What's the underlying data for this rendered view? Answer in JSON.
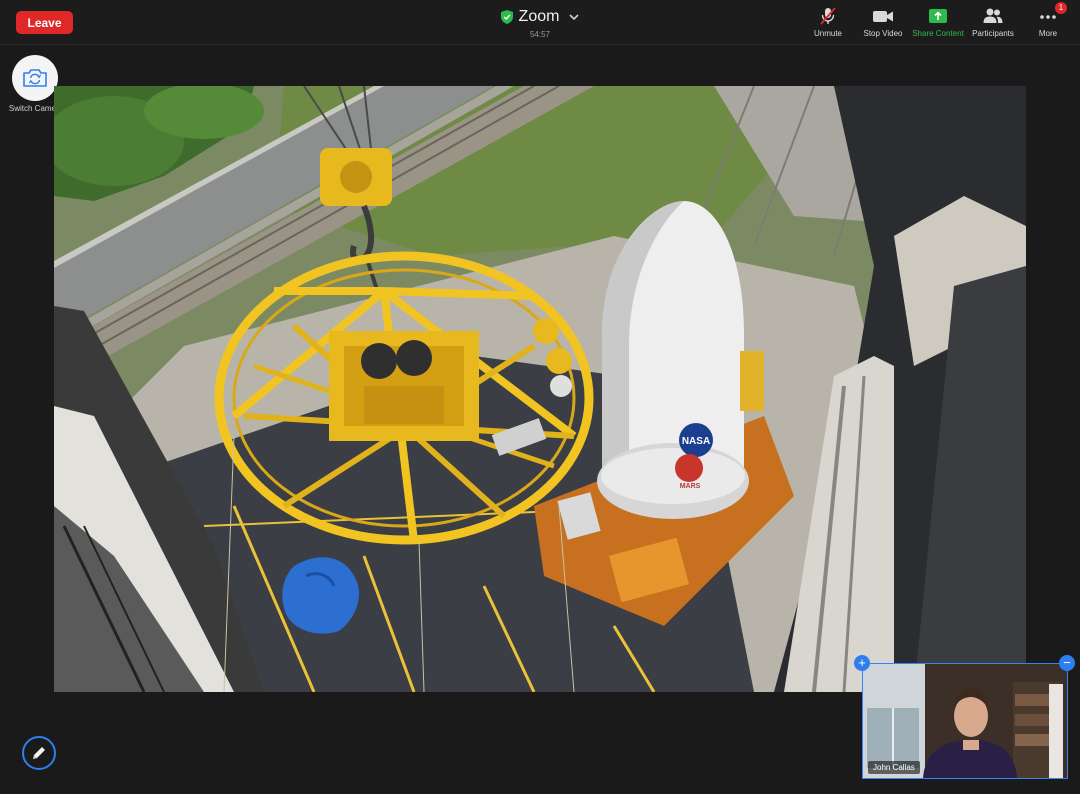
{
  "toolbar": {
    "leave_label": "Leave",
    "app_title": "Zoom",
    "timer": "54:57",
    "tools": [
      {
        "label": "Unmute",
        "icon": "mic-muted-icon"
      },
      {
        "label": "Stop Video",
        "icon": "video-camera-icon"
      },
      {
        "label": "Share Content",
        "icon": "share-screen-icon",
        "color": "#2dbb4e"
      },
      {
        "label": "Participants",
        "icon": "participants-icon"
      },
      {
        "label": "More",
        "icon": "more-dots-icon",
        "badge": "1"
      }
    ]
  },
  "camera": {
    "switch_label": "Switch Camera"
  },
  "shared_content": {
    "nasa_logo": "NASA",
    "mars_logo": "MARS"
  },
  "thumbnail": {
    "participant_name": "John Callas",
    "expand_symbol": "+",
    "collapse_symbol": "−"
  },
  "colors": {
    "leave": "#e02828",
    "accent": "#2e7ef0",
    "share_green": "#2dbb4e"
  }
}
